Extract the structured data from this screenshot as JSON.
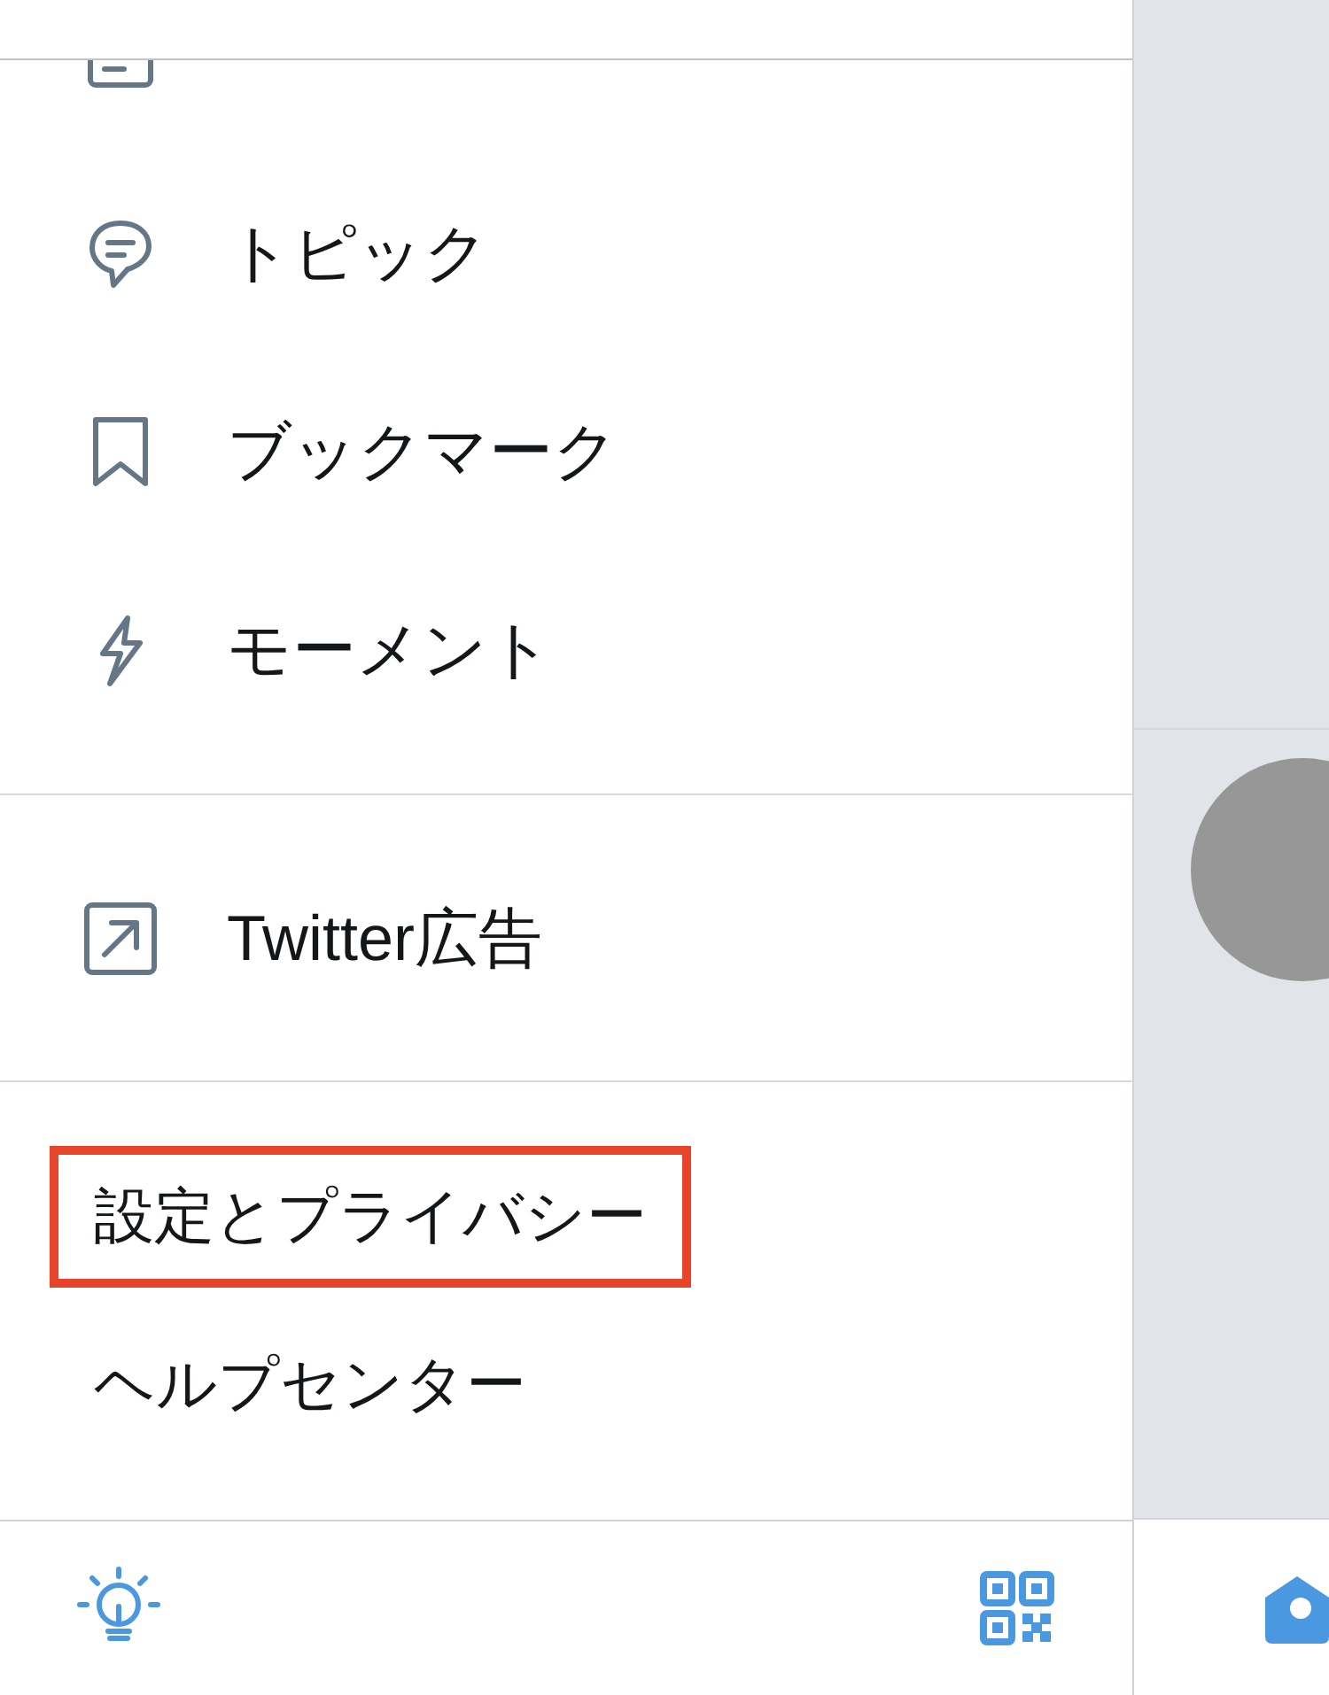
{
  "primary_items": [
    {
      "kind": "list"
    },
    {
      "kind": "topic",
      "label": "トピック"
    },
    {
      "kind": "bookmark",
      "label": "ブックマーク"
    },
    {
      "kind": "moment",
      "label": "モーメント"
    }
  ],
  "secondary_items": [
    {
      "kind": "external",
      "label": "Twitter広告"
    }
  ],
  "text_items": [
    {
      "label": "設定とプライバシー",
      "highlighted": true
    },
    {
      "label": "ヘルプセンター",
      "highlighted": false
    }
  ]
}
